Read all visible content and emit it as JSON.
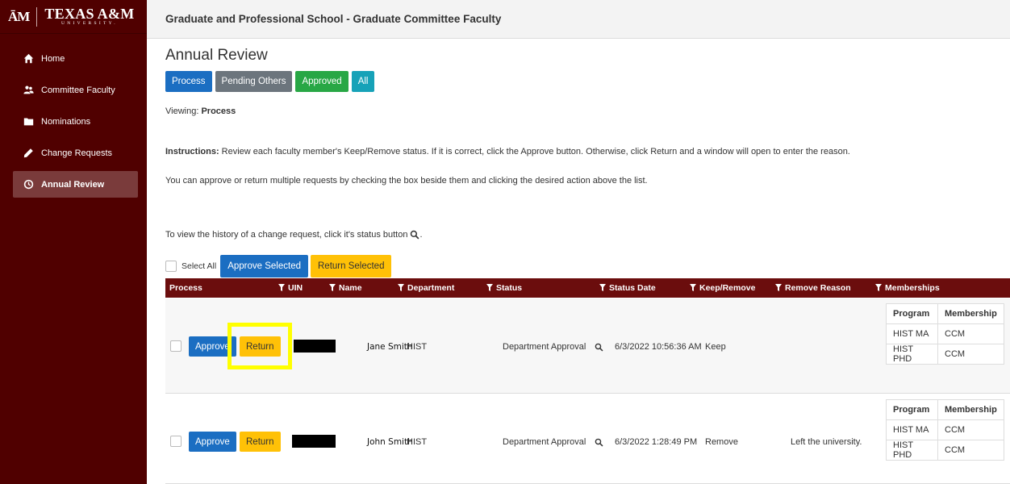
{
  "brand": {
    "mark": "ĀM",
    "name": "TEXAS A&M",
    "sub": "UNIVERSITY."
  },
  "sidebar": {
    "items": [
      {
        "label": "Home",
        "icon": "home-icon"
      },
      {
        "label": "Committee Faculty",
        "icon": "users-icon"
      },
      {
        "label": "Nominations",
        "icon": "folder-icon"
      },
      {
        "label": "Change Requests",
        "icon": "pencil-icon"
      },
      {
        "label": "Annual Review",
        "icon": "clock-icon",
        "active": true
      }
    ]
  },
  "header": {
    "title": "Graduate and Professional School - Graduate Committee Faculty"
  },
  "page": {
    "title": "Annual Review",
    "filters": [
      "Process",
      "Pending Others",
      "Approved",
      "All"
    ],
    "viewing_label": "Viewing:",
    "viewing_value": "Process",
    "instructions_label": "Instructions:",
    "instructions_text": " Review each faculty member's Keep/Remove status. If it is correct, click the Approve button. Otherwise, click Return and a window will open to enter the reason.",
    "multi_text": "You can approve or return multiple requests by checking the box beside them and clicking the desired action above the list.",
    "history_text": "To view the history of a change request, click it's status button"
  },
  "bulk": {
    "select_all": "Select All",
    "approve": "Approve Selected",
    "return": "Return Selected"
  },
  "table": {
    "headers": [
      "Process",
      "UIN",
      "Name",
      "Department",
      "Status",
      "Status Date",
      "Keep/Remove",
      "Remove Reason",
      "Memberships"
    ],
    "approve_label": "Approve",
    "return_label": "Return",
    "membership_headers": [
      "Program",
      "Membership"
    ],
    "rows": [
      {
        "name": "Jane Smith",
        "department": "HIST",
        "status": "Department Approval",
        "status_date": "6/3/2022 10:56:36 AM",
        "keep_remove": "Keep",
        "remove_reason": "",
        "memberships": [
          {
            "program": "HIST MA",
            "membership": "CCM"
          },
          {
            "program": "HIST PHD",
            "membership": "CCM"
          }
        ]
      },
      {
        "name": "John Smith",
        "department": "HIST",
        "status": "Department Approval",
        "status_date": "6/3/2022 1:28:49 PM",
        "keep_remove": "Remove",
        "remove_reason": "Left the university.",
        "memberships": [
          {
            "program": "HIST MA",
            "membership": "CCM"
          },
          {
            "program": "HIST PHD",
            "membership": "CCM"
          }
        ]
      }
    ]
  },
  "colors": {
    "maroon": "#500000",
    "header_maroon": "#6b0d0d",
    "primary": "#1b6ec2",
    "warning": "#ffc107",
    "success": "#28a745",
    "info": "#17a2b8",
    "highlight": "#ffff00"
  }
}
